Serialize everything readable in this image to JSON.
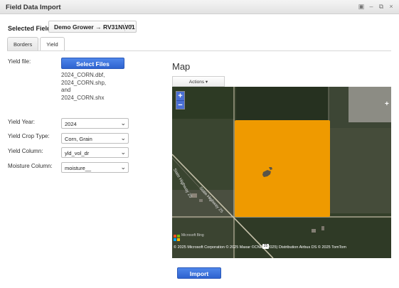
{
  "window": {
    "title": "Field Data Import",
    "controls": [
      "pin-icon",
      "minimize-icon",
      "restore-icon",
      "close-icon"
    ]
  },
  "selected_field": {
    "label": "Selected Field:",
    "value": "Demo Grower → RV31NW01"
  },
  "tabs": [
    {
      "label": "Borders",
      "active": false
    },
    {
      "label": "Yield",
      "active": true
    }
  ],
  "form": {
    "yield_file_label": "Yield file:",
    "select_files_button": "Select Files",
    "files": [
      "2024_CORN.dbf,",
      "2024_CORN.shp,",
      "and",
      "2024_CORN.shx"
    ],
    "yield_year": {
      "label": "Yield Year:",
      "value": "2024"
    },
    "yield_crop_type": {
      "label": "Yield Crop Type:",
      "value": "Corn, Grain"
    },
    "yield_column": {
      "label": "Yield Column:",
      "value": "yld_vol_dr"
    },
    "moisture_column": {
      "label": "Moisture Column:",
      "value": "moisture__"
    }
  },
  "map": {
    "title": "Map",
    "actions_label": "Actions ▾",
    "zoom_in": "+",
    "zoom_out": "−",
    "side_plus": "+",
    "provider": "Microsoft Bing",
    "attribution": "© 2025 Microsoft Corporation © 2025 Maxar ©CNES (2025) Distribution Airbus DS © 2025 TomTom",
    "road_number": "25",
    "road_labels": [
      "State Highway 25",
      "State Highway 25"
    ],
    "field_color": "#ef9a00"
  },
  "import_button": "Import"
}
